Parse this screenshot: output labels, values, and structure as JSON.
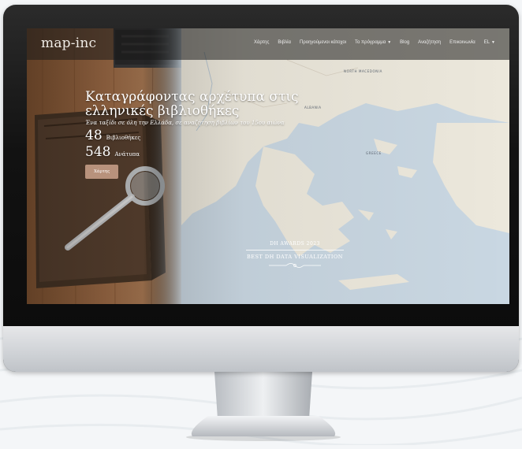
{
  "site": {
    "brand": "map-inc"
  },
  "nav": {
    "items": [
      {
        "label": "Χάρτης",
        "has_menu": false
      },
      {
        "label": "Βιβλία",
        "has_menu": false
      },
      {
        "label": "Προηγούμενοι κάτοχοι",
        "has_menu": false
      },
      {
        "label": "Το πρόγραμμα",
        "has_menu": true
      },
      {
        "label": "Blog",
        "has_menu": false
      },
      {
        "label": "Αναζήτηση",
        "has_menu": false
      },
      {
        "label": "Επικοινωνία",
        "has_menu": false
      },
      {
        "label": "EL",
        "has_menu": true
      }
    ],
    "caret_icon": "caret-down-icon"
  },
  "hero": {
    "title": "Καταγράφοντας αρχέτυπα στις ελληνικές βιβλιοθήκες",
    "subtitle": "Ένα ταξίδι σε όλη την Ελλάδα, σε αναζήτηση βιβλίων του 15ου αιώνα",
    "stats": [
      {
        "value": "48",
        "label": "Βιβλιοθήκες"
      },
      {
        "value": "548",
        "label": "Ανάτυπα"
      }
    ],
    "button_label": "Χάρτης"
  },
  "award": {
    "line1": "DH AWARDS 2023",
    "line2": "BEST DH DATA VISUALIZATION"
  },
  "map_labels": {
    "north_macedonia": "NORTH MACEDONIA",
    "albania": "ALBANIA",
    "greece": "GREECE"
  },
  "colors": {
    "button": "#b8927c",
    "sea": "#c9d7e2",
    "land": "#ece8dc",
    "navbar": "#191919"
  }
}
